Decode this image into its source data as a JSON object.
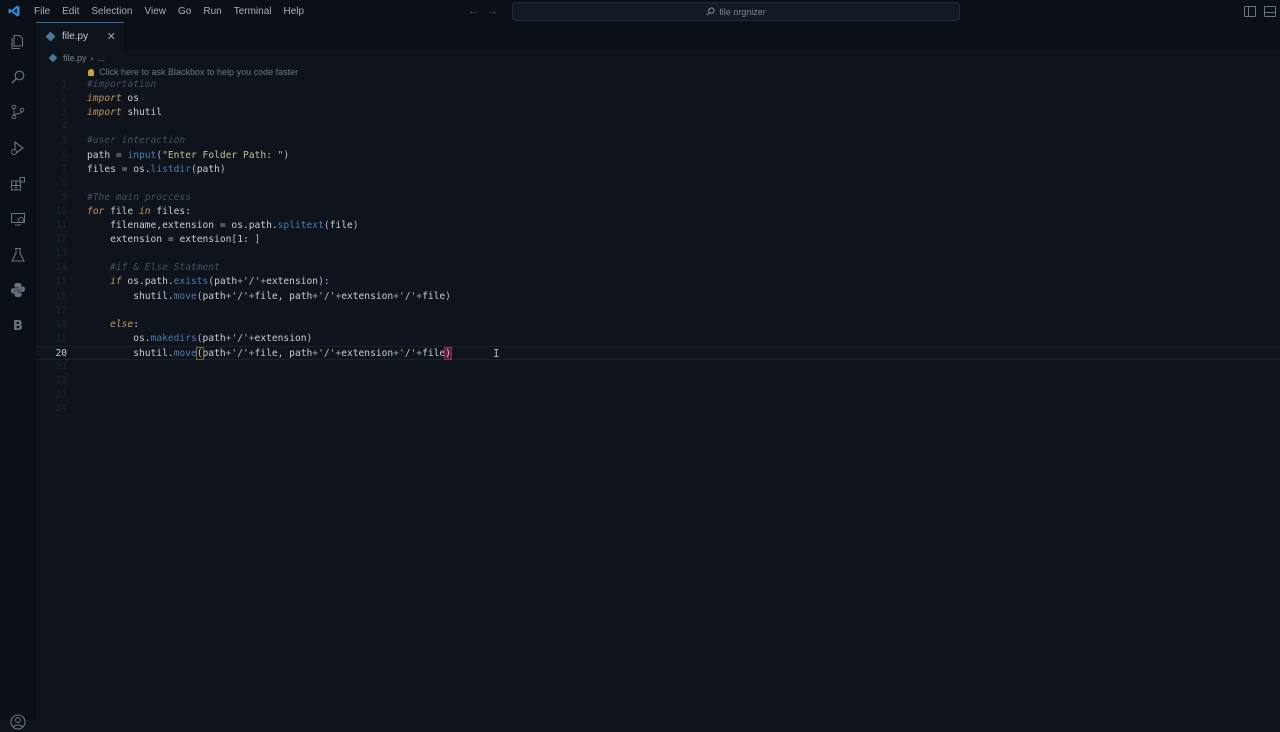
{
  "titlebar": {
    "menu": [
      "File",
      "Edit",
      "Selection",
      "View",
      "Go",
      "Run",
      "Terminal",
      "Help"
    ],
    "search_text": "file orgnizer",
    "back_arrow": "←",
    "forward_arrow": "→"
  },
  "activity_icons": [
    "explorer-icon",
    "search-icon",
    "source-control-icon",
    "run-debug-icon",
    "extensions-icon",
    "remote-explorer-icon",
    "testing-icon",
    "python-icon",
    "blackbox-icon"
  ],
  "blackbox_letter": "B",
  "tab": {
    "label": "file.py",
    "close": "✕"
  },
  "breadcrumb": {
    "file": "file.py",
    "separator": "›",
    "more": "..."
  },
  "hint": "Click here to ask Blackbox to help you code faster",
  "editor": {
    "active_line": 20,
    "line_numbers": [
      "1",
      "2",
      "3",
      "4",
      "5",
      "6",
      "7",
      "8",
      "9",
      "10",
      "11",
      "12",
      "13",
      "14",
      "15",
      "16",
      "17",
      "18",
      "19",
      "20",
      "21",
      "22",
      "23",
      "24"
    ],
    "lines": [
      [
        {
          "t": "#importation",
          "c": "comment"
        }
      ],
      [
        {
          "t": "import",
          "c": "kw"
        },
        {
          "t": " os",
          "c": "var"
        }
      ],
      [
        {
          "t": "import",
          "c": "kw"
        },
        {
          "t": " shutil",
          "c": "var"
        }
      ],
      [],
      [
        {
          "t": "#user interaction",
          "c": "comment"
        }
      ],
      [
        {
          "t": "path ",
          "c": "var"
        },
        {
          "t": "= ",
          "c": "op"
        },
        {
          "t": "input",
          "c": "fn"
        },
        {
          "t": "(",
          "c": "br"
        },
        {
          "t": "\"Enter Folder Path: \"",
          "c": "str"
        },
        {
          "t": ")",
          "c": "br"
        }
      ],
      [
        {
          "t": "files ",
          "c": "var"
        },
        {
          "t": "= ",
          "c": "op"
        },
        {
          "t": "os.",
          "c": "var"
        },
        {
          "t": "listdir",
          "c": "fn"
        },
        {
          "t": "(",
          "c": "br"
        },
        {
          "t": "path",
          "c": "var"
        },
        {
          "t": ")",
          "c": "br"
        }
      ],
      [],
      [
        {
          "t": "#The main proccess",
          "c": "comment"
        }
      ],
      [
        {
          "t": "for",
          "c": "kw"
        },
        {
          "t": " file ",
          "c": "var"
        },
        {
          "t": "in",
          "c": "kw"
        },
        {
          "t": " files:",
          "c": "var"
        }
      ],
      [
        {
          "t": "    filename,extension ",
          "c": "var"
        },
        {
          "t": "= ",
          "c": "op"
        },
        {
          "t": "os.path.",
          "c": "var"
        },
        {
          "t": "splitext",
          "c": "fn"
        },
        {
          "t": "(",
          "c": "br"
        },
        {
          "t": "file",
          "c": "var"
        },
        {
          "t": ")",
          "c": "br"
        }
      ],
      [
        {
          "t": "    extension ",
          "c": "var"
        },
        {
          "t": "= ",
          "c": "op"
        },
        {
          "t": "extension",
          "c": "var"
        },
        {
          "t": "[",
          "c": "br"
        },
        {
          "t": "1: ",
          "c": "num"
        },
        {
          "t": "]",
          "c": "br"
        }
      ],
      [],
      [
        {
          "t": "    #if & Else Statment",
          "c": "comment"
        }
      ],
      [
        {
          "t": "    if",
          "c": "kw"
        },
        {
          "t": " os.path.",
          "c": "var"
        },
        {
          "t": "exists",
          "c": "fn"
        },
        {
          "t": "(",
          "c": "br"
        },
        {
          "t": "path",
          "c": "var"
        },
        {
          "t": "+",
          "c": "op"
        },
        {
          "t": "'/'",
          "c": "str"
        },
        {
          "t": "+",
          "c": "op"
        },
        {
          "t": "extension",
          "c": "var"
        },
        {
          "t": "):",
          "c": "br"
        }
      ],
      [
        {
          "t": "        shutil.",
          "c": "var"
        },
        {
          "t": "move",
          "c": "fn"
        },
        {
          "t": "(",
          "c": "br"
        },
        {
          "t": "path",
          "c": "var"
        },
        {
          "t": "+",
          "c": "op"
        },
        {
          "t": "'/'",
          "c": "str"
        },
        {
          "t": "+",
          "c": "op"
        },
        {
          "t": "file, path",
          "c": "var"
        },
        {
          "t": "+",
          "c": "op"
        },
        {
          "t": "'/'",
          "c": "str"
        },
        {
          "t": "+",
          "c": "op"
        },
        {
          "t": "extension",
          "c": "var"
        },
        {
          "t": "+",
          "c": "op"
        },
        {
          "t": "'/'",
          "c": "str"
        },
        {
          "t": "+",
          "c": "op"
        },
        {
          "t": "file",
          "c": "var"
        },
        {
          "t": ")",
          "c": "br"
        }
      ],
      [],
      [
        {
          "t": "    else",
          "c": "kw"
        },
        {
          "t": ":",
          "c": "var"
        }
      ],
      [
        {
          "t": "        os.",
          "c": "var"
        },
        {
          "t": "makedirs",
          "c": "fn"
        },
        {
          "t": "(",
          "c": "br"
        },
        {
          "t": "path",
          "c": "var"
        },
        {
          "t": "+",
          "c": "op"
        },
        {
          "t": "'/'",
          "c": "str"
        },
        {
          "t": "+",
          "c": "op"
        },
        {
          "t": "extension",
          "c": "var"
        },
        {
          "t": ")",
          "c": "br"
        }
      ],
      [
        {
          "t": "        shutil.",
          "c": "var"
        },
        {
          "t": "move",
          "c": "fn"
        },
        {
          "t": "(",
          "c": "match"
        },
        {
          "t": "path",
          "c": "var"
        },
        {
          "t": "+",
          "c": "op"
        },
        {
          "t": "'/'",
          "c": "str"
        },
        {
          "t": "+",
          "c": "op"
        },
        {
          "t": "file, path",
          "c": "var"
        },
        {
          "t": "+",
          "c": "op"
        },
        {
          "t": "'/'",
          "c": "str"
        },
        {
          "t": "+",
          "c": "op"
        },
        {
          "t": "extension",
          "c": "var"
        },
        {
          "t": "+",
          "c": "op"
        },
        {
          "t": "'/'",
          "c": "str"
        },
        {
          "t": "+",
          "c": "op"
        },
        {
          "t": "file",
          "c": "var"
        },
        {
          "t": ")",
          "c": "match-end"
        }
      ],
      [],
      [],
      [],
      []
    ]
  },
  "cursor_glyph": "I"
}
